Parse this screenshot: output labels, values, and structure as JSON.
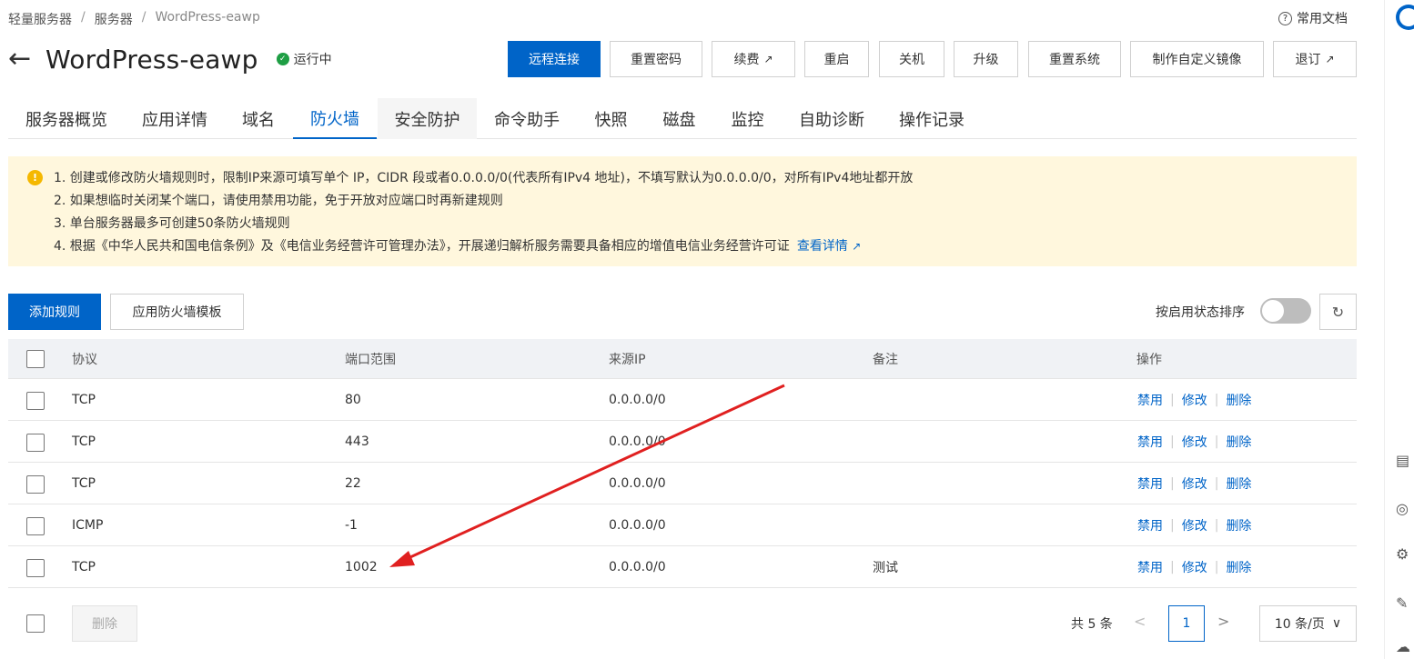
{
  "breadcrumb": [
    "轻量服务器",
    "服务器",
    "WordPress-eawp"
  ],
  "help_label": "常用文档",
  "title": "WordPress-eawp",
  "status": "运行中",
  "actions": [
    "远程连接",
    "重置密码",
    "续费",
    "重启",
    "关机",
    "升级",
    "重置系统",
    "制作自定义镜像",
    "退订"
  ],
  "tabs": [
    "服务器概览",
    "应用详情",
    "域名",
    "防火墙",
    "安全防护",
    "命令助手",
    "快照",
    "磁盘",
    "监控",
    "自助诊断",
    "操作记录"
  ],
  "active_tab": "防火墙",
  "notice": {
    "lines": [
      "1. 创建或修改防火墙规则时，限制IP来源可填写单个 IP，CIDR 段或者0.0.0.0/0(代表所有IPv4 地址)，不填写默认为0.0.0.0/0，对所有IPv4地址都开放",
      "2. 如果想临时关闭某个端口，请使用禁用功能，免于开放对应端口时再新建规则",
      "3. 单台服务器最多可创建50条防火墙规则",
      "4. 根据《中华人民共和国电信条例》及《电信业务经营许可管理办法》，开展递归解析服务需要具备相应的增值电信业务经营许可证"
    ],
    "link": "查看详情"
  },
  "toolbar": {
    "add": "添加规则",
    "template": "应用防火墙模板",
    "sort_label": "按启用状态排序"
  },
  "table": {
    "headers": [
      "协议",
      "端口范围",
      "来源IP",
      "备注",
      "操作"
    ],
    "rows": [
      {
        "protocol": "TCP",
        "port": "80",
        "source": "0.0.0.0/0",
        "note": ""
      },
      {
        "protocol": "TCP",
        "port": "443",
        "source": "0.0.0.0/0",
        "note": ""
      },
      {
        "protocol": "TCP",
        "port": "22",
        "source": "0.0.0.0/0",
        "note": ""
      },
      {
        "protocol": "ICMP",
        "port": "-1",
        "source": "0.0.0.0/0",
        "note": ""
      },
      {
        "protocol": "TCP",
        "port": "1002",
        "source": "0.0.0.0/0",
        "note": "测试"
      }
    ],
    "ops": [
      "禁用",
      "修改",
      "删除"
    ]
  },
  "footer": {
    "delete": "删除",
    "total": "共 5 条",
    "page": "1",
    "page_size": "10 条/页"
  },
  "colors": {
    "primary": "#0064c8",
    "notice_bg": "#fff7dd",
    "annotation": "#e02020"
  }
}
